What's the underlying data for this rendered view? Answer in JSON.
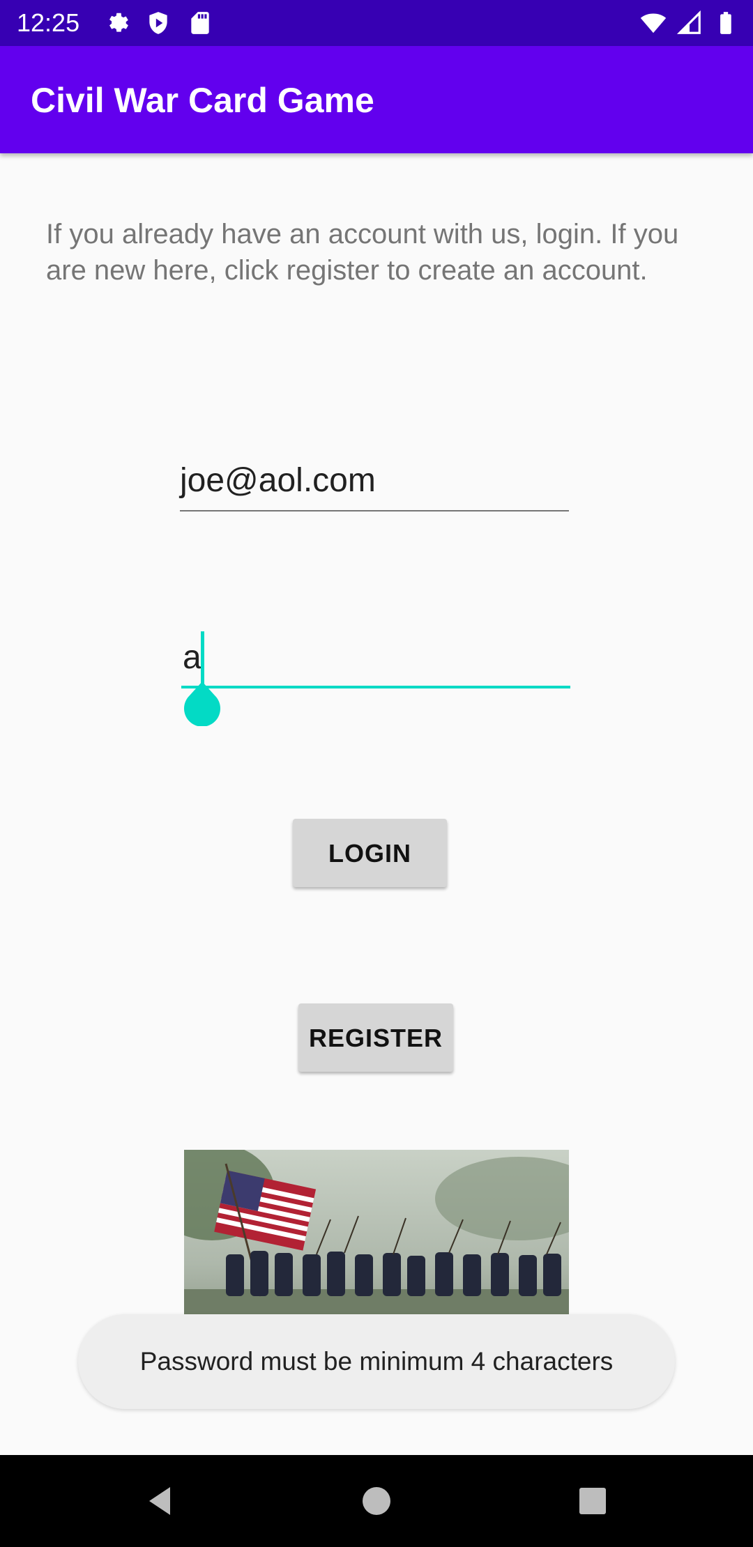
{
  "status_bar": {
    "time": "12:25",
    "left_icons": [
      "gear-icon",
      "shield-icon",
      "sd-card-icon"
    ],
    "right_icons": [
      "wifi-icon",
      "signal-icon",
      "battery-icon"
    ]
  },
  "app_bar": {
    "title": "Civil War Card Game",
    "color": "#6200ee"
  },
  "intro": {
    "text": "If you already have an account with us, login. If you are new here, click register to create an account."
  },
  "form": {
    "email_value": "joe@aol.com",
    "password_value": "a",
    "accent_color": "#03dac5"
  },
  "buttons": {
    "login_label": "LOGIN",
    "register_label": "REGISTER"
  },
  "image": {
    "subject": "civil-war-soldiers-marching-with-american-flag"
  },
  "toast": {
    "message": "Password must be minimum 4 characters"
  },
  "nav_bar": {
    "icons": [
      "back-icon",
      "home-icon",
      "recents-icon"
    ]
  }
}
